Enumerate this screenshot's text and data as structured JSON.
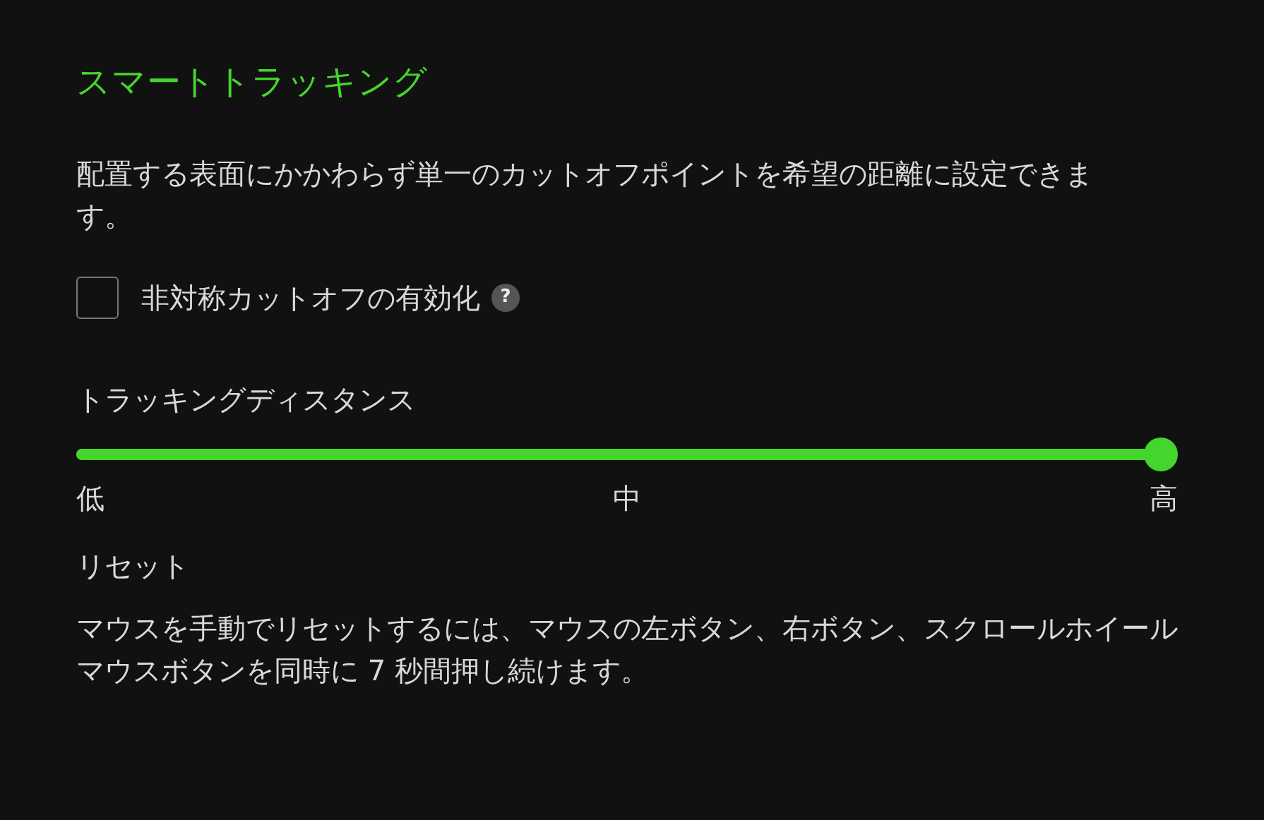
{
  "title": "スマートトラッキング",
  "description": "配置する表面にかかわらず単一のカットオフポイントを希望の距離に設定できます。",
  "asymmetric_cutoff": {
    "label": "非対称カットオフの有効化",
    "checked": false,
    "help": "?"
  },
  "tracking_distance": {
    "label": "トラッキングディスタンス",
    "level": 1,
    "ticks": [
      "低",
      "中",
      "高"
    ]
  },
  "reset": {
    "label": "リセット",
    "text": "マウスを手動でリセットするには、マウスの左ボタン、右ボタン、スクロールホイールマウスボタンを同時に 7 秒間押し続けます。"
  }
}
